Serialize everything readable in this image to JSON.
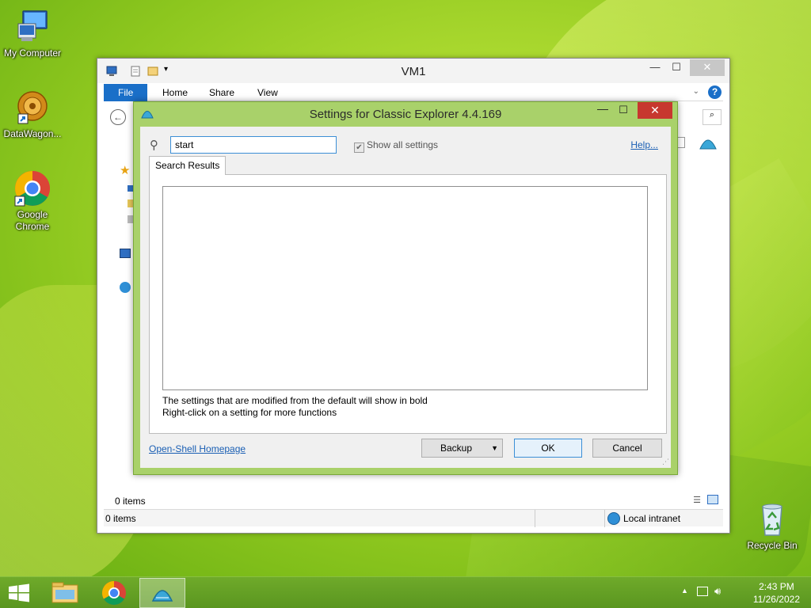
{
  "desktop": {
    "icons": [
      {
        "label": "My Computer"
      },
      {
        "label": "DataWagon..."
      },
      {
        "label": "Google Chrome"
      },
      {
        "label": "Recycle Bin"
      }
    ]
  },
  "explorer": {
    "title": "VM1",
    "tabs": [
      "File",
      "Home",
      "Share",
      "View"
    ],
    "items_count": "0 items",
    "status_items": "0 items",
    "zone": "Local intranet"
  },
  "dialog": {
    "title": "Settings for Classic Explorer 4.4.169",
    "search_value": "start",
    "show_all_label": "Show all settings",
    "help_label": "Help...",
    "tab_label": "Search Results",
    "hint1": "The settings that are modified from the default will show in bold",
    "hint2": "Right-click on a setting for more functions",
    "homepage_label": "Open-Shell Homepage",
    "backup_label": "Backup",
    "ok_label": "OK",
    "cancel_label": "Cancel"
  },
  "taskbar": {
    "time": "2:43 PM",
    "date": "11/26/2022"
  },
  "colors": {
    "dialog_frame": "#a9d16a",
    "file_tab": "#1a6fc8",
    "close_button": "#c7372f",
    "taskbar": "#5a9620",
    "link": "#1a5fb4"
  }
}
